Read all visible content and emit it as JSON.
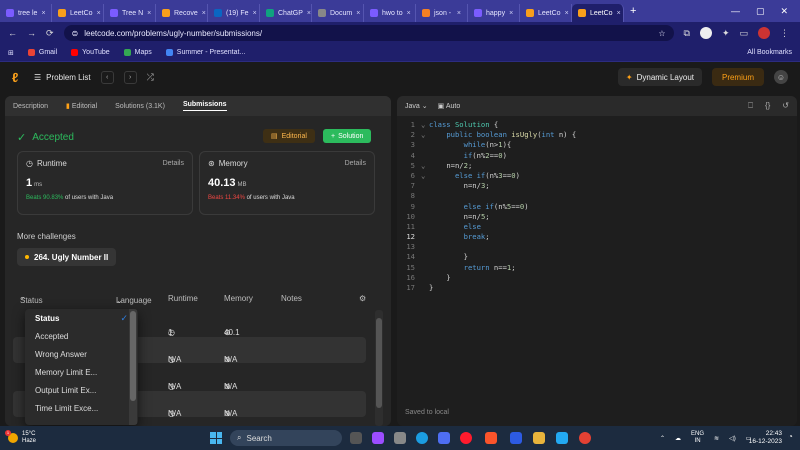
{
  "browser": {
    "tabs": [
      {
        "label": "tree le",
        "color": "#7b5cff"
      },
      {
        "label": "LeetCo",
        "color": "#f89f1b"
      },
      {
        "label": "Tree N",
        "color": "#7b5cff"
      },
      {
        "label": "Recove",
        "color": "#f89f1b"
      },
      {
        "label": "(19) Fe",
        "color": "#0a66c2"
      },
      {
        "label": "ChatGP",
        "color": "#10a37f"
      },
      {
        "label": "Docum",
        "color": "#888888"
      },
      {
        "label": "hwo to",
        "color": "#7b5cff"
      },
      {
        "label": "json -",
        "color": "#f48024"
      },
      {
        "label": "happy",
        "color": "#7b5cff"
      },
      {
        "label": "LeetCo",
        "color": "#f89f1b"
      },
      {
        "label": "LeetCo",
        "color": "#f89f1b",
        "active": true
      }
    ],
    "new_tab": "+",
    "url": "leetcode.com/problems/ugly-number/submissions/",
    "bookmarks": [
      {
        "label": "Gmail",
        "color": "#ea4335"
      },
      {
        "label": "YouTube",
        "color": "#ff0000"
      },
      {
        "label": "Maps",
        "color": "#34a853"
      },
      {
        "label": "Summer - Presentat...",
        "color": "#4285f4"
      }
    ],
    "all_bookmarks": "All Bookmarks"
  },
  "header": {
    "problem_list": "Problem List",
    "dynamic_layout": "Dynamic Layout",
    "premium": "Premium"
  },
  "left": {
    "tabs": [
      "Description",
      "Editorial",
      "Solutions (3.1K)",
      "Submissions"
    ],
    "accepted": "Accepted",
    "editorial_btn": "Editorial",
    "solution_btn": "Solution",
    "runtime": {
      "title": "Runtime",
      "details": "Details",
      "value": "1",
      "unit": "ms",
      "beats_pct": "Beats 90.83%",
      "beats_rest": "of users with Java"
    },
    "memory": {
      "title": "Memory",
      "details": "Details",
      "value": "40.13",
      "unit": "MB",
      "beats_pct": "Beats 11.34%",
      "beats_rest": "of users with Java"
    },
    "more_challenges": "More challenges",
    "challenge": "264. Ugly Number II",
    "columns": {
      "status": "Status",
      "language": "Language",
      "runtime": "Runtime",
      "memory": "Memory",
      "notes": "Notes"
    },
    "rows": [
      {
        "runtime": "1 ms",
        "memory": "40.1 MB"
      },
      {
        "runtime": "N/A",
        "memory": "N/A"
      },
      {
        "runtime": "N/A",
        "memory": "N/A"
      },
      {
        "runtime": "N/A",
        "memory": "N/A"
      }
    ],
    "status_dropdown": [
      "Status",
      "Accepted",
      "Wrong Answer",
      "Memory Limit E...",
      "Output Limit Ex...",
      "Time Limit Exce..."
    ]
  },
  "right": {
    "language": "Java",
    "auto": "Auto",
    "saved": "Saved to local",
    "code_lines": [
      "class Solution {",
      "    public boolean isUgly(int n) {",
      "        while(n>1){",
      "        if(n%2==0)",
      "    n=n/2;",
      "      else if(n%3==0)",
      "        n=n/3;",
      "",
      "        else if(n%5==0)",
      "        n=n/5;",
      "        else",
      "        break;",
      "",
      "        }",
      "        return n==1;",
      "    }",
      "}"
    ]
  },
  "taskbar": {
    "temp": "15°C",
    "weather": "Haze",
    "search": "Search",
    "lang_1": "ENG",
    "lang_2": "IN",
    "time": "22:43",
    "date": "16-12-2023"
  }
}
